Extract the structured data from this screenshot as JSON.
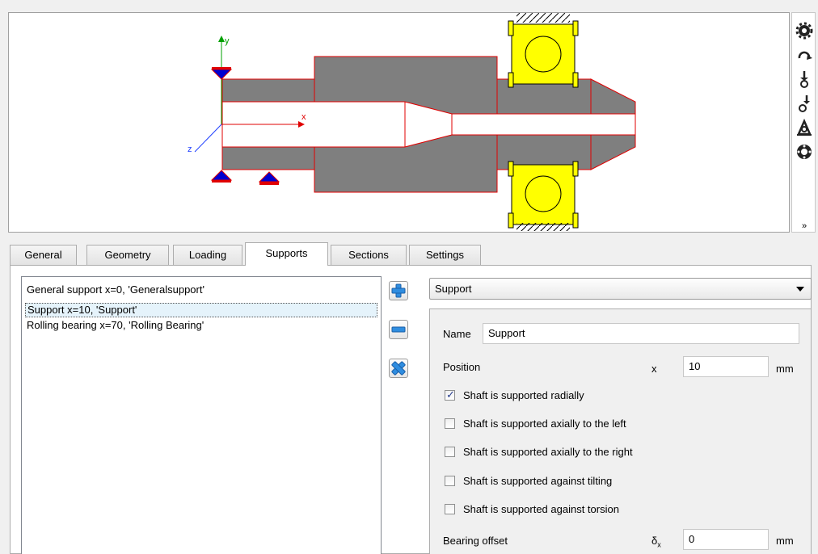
{
  "viewport": {
    "axes": {
      "y": "y",
      "x": "x",
      "z": "z"
    }
  },
  "toolbar": {
    "tools": [
      {
        "name": "gear-settings-icon"
      },
      {
        "name": "torque-icon"
      },
      {
        "name": "point-force-icon"
      },
      {
        "name": "force-offset-icon"
      },
      {
        "name": "support-icon"
      },
      {
        "name": "rolling-bearing-icon"
      }
    ],
    "more": "»"
  },
  "tabs": [
    "General",
    "Geometry",
    "Loading",
    "Supports",
    "Sections",
    "Settings"
  ],
  "active_tab": "Supports",
  "support_list": [
    "General support  x=0, 'Generalsupport'",
    "Support  x=10, 'Support'",
    "Rolling bearing  x=70, 'Rolling Bearing'"
  ],
  "selected_index": 1,
  "support_type": "Support",
  "props": {
    "name_label": "Name",
    "name_value": "Support",
    "position_label": "Position",
    "position_symbol": "x",
    "position_value": "10",
    "position_unit": "mm",
    "checkboxes": [
      {
        "label": "Shaft is supported radially",
        "checked": true
      },
      {
        "label": "Shaft is supported axially to the left",
        "checked": false
      },
      {
        "label": "Shaft is supported axially to the right",
        "checked": false
      },
      {
        "label": "Shaft is supported against tilting",
        "checked": false
      },
      {
        "label": "Shaft is supported against torsion",
        "checked": false
      }
    ],
    "offset_label": "Bearing offset",
    "offset_symbol": "δ",
    "offset_subscript": "x",
    "offset_value": "0",
    "offset_unit": "mm"
  },
  "colors": {
    "shaft_fill": "#7f7f7f",
    "outline": "#e00000",
    "bearing": "#ffff00",
    "support": "#0000d0"
  }
}
